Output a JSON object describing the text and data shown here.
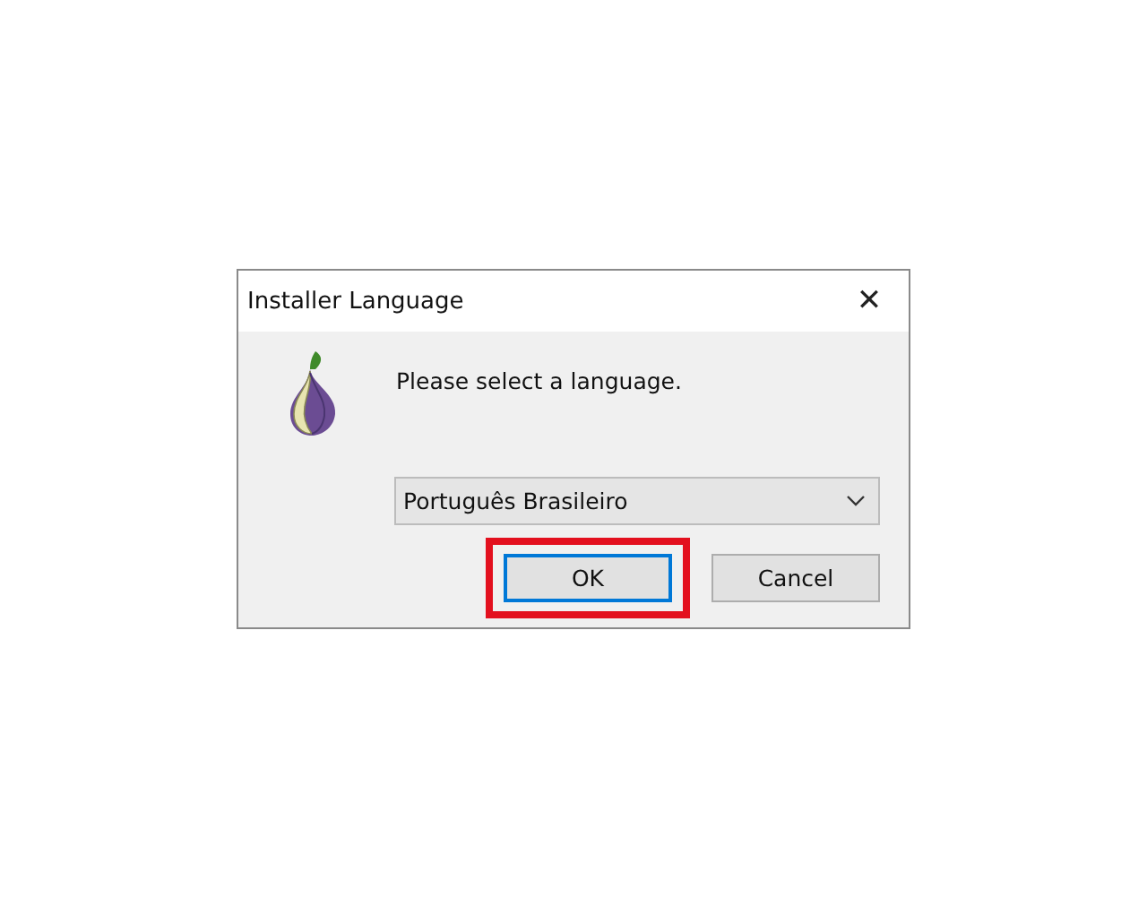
{
  "window": {
    "title": "Installer Language",
    "close": "✕"
  },
  "prompt": "Please select a language.",
  "language_select": {
    "value": "Português Brasileiro"
  },
  "buttons": [
    {
      "label": "OK",
      "kind": "default",
      "highlighted": true
    },
    {
      "label": "Cancel",
      "kind": "normal",
      "highlighted": false
    }
  ]
}
